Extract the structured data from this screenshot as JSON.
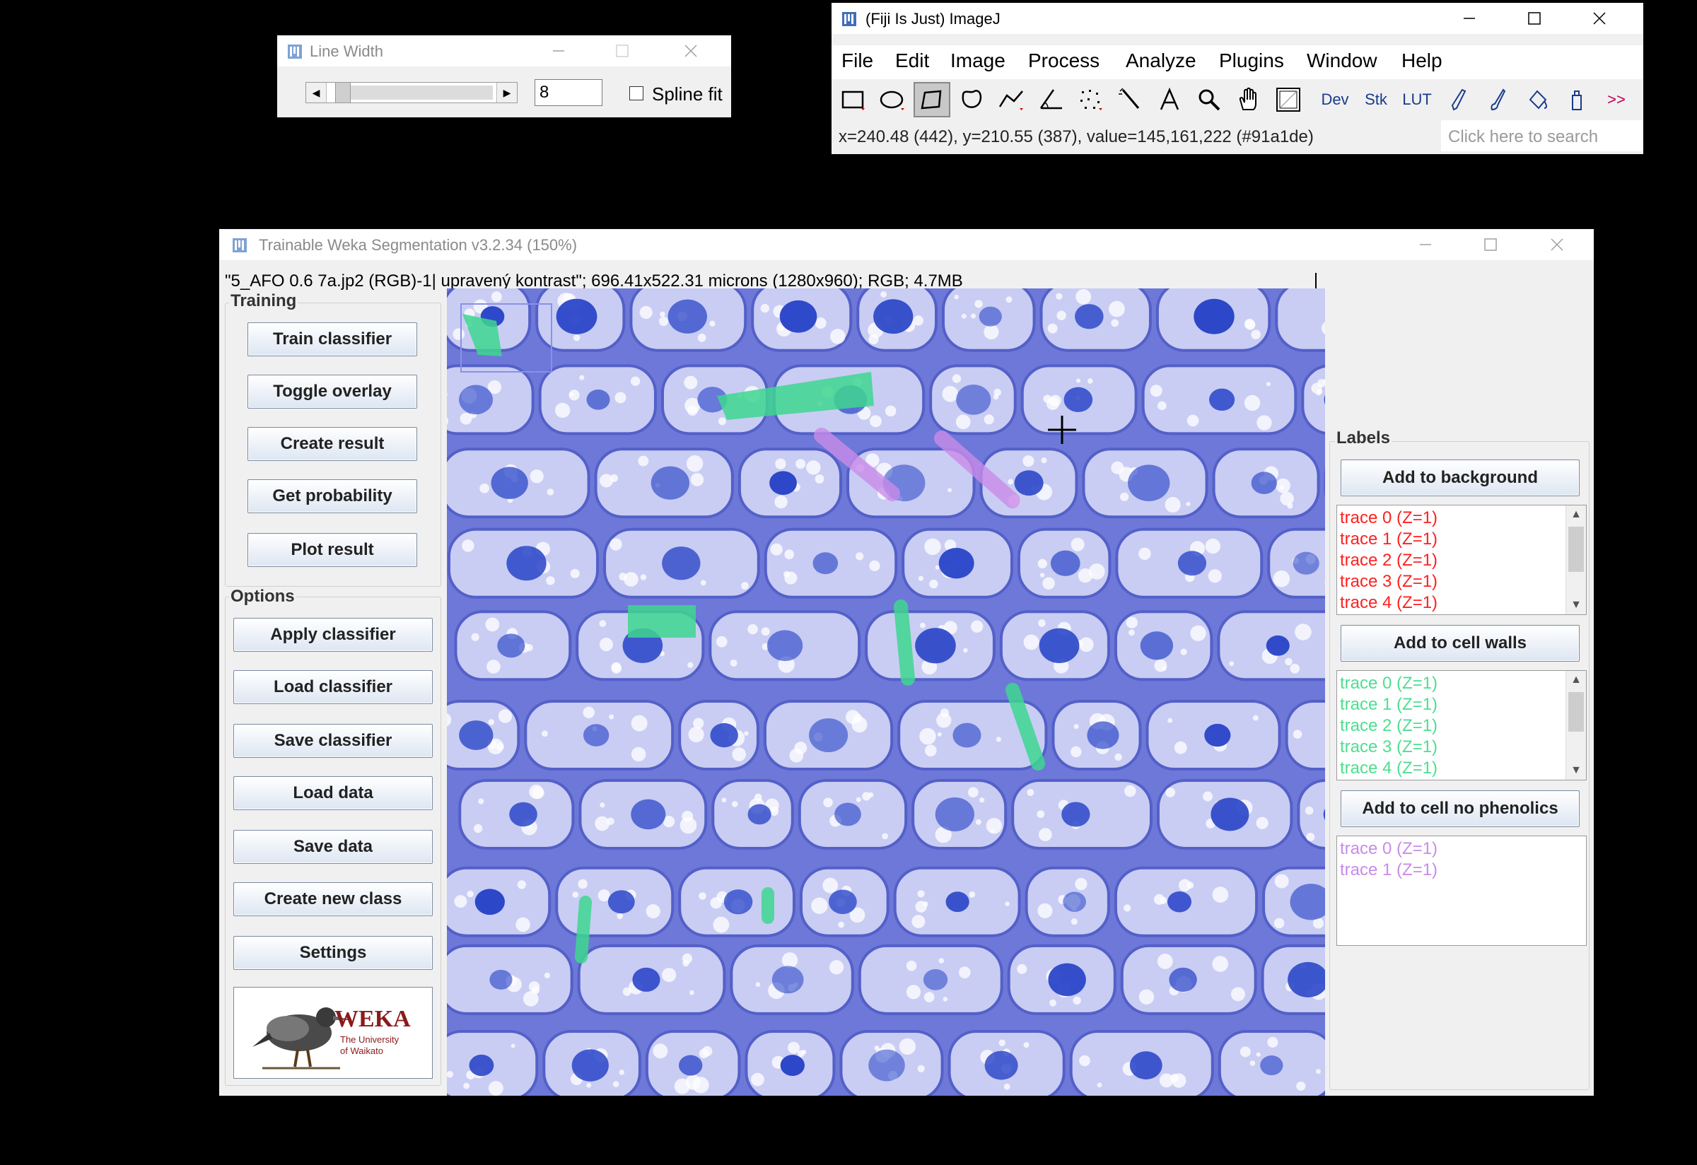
{
  "line_width_dialog": {
    "title": "Line Width",
    "value": "8",
    "spline_fit_label": "Spline fit",
    "spline_fit_checked": false,
    "slider_fraction": 0.05
  },
  "imagej": {
    "title": "(Fiji Is Just) ImageJ",
    "menu": [
      "File",
      "Edit",
      "Image",
      "Process",
      "Analyze",
      "Plugins",
      "Window",
      "Help"
    ],
    "tools": [
      "Dev",
      "Stk",
      "LUT",
      ">>"
    ],
    "status": "x=240.48 (442), y=210.55 (387), value=145,161,222 (#91a1de)",
    "search_placeholder": "Click here to search"
  },
  "weka": {
    "title": "Trainable Weka Segmentation v3.2.34 (150%)",
    "info": "\"5_AFO 0.6 7a.jp2 (RGB)-1| upravený kontrast\"; 696.41x522.31 microns (1280x960); RGB; 4.7MB",
    "training": {
      "label": "Training",
      "buttons": [
        "Train classifier",
        "Toggle overlay",
        "Create result",
        "Get probability",
        "Plot result"
      ]
    },
    "options": {
      "label": "Options",
      "buttons": [
        "Apply classifier",
        "Load classifier",
        "Save classifier",
        "Load data",
        "Save data",
        "Create new class",
        "Settings"
      ]
    },
    "logo": {
      "text": "WEKA",
      "subtitle_1": "The University",
      "subtitle_2": "of Waikato"
    },
    "labels": {
      "label": "Labels",
      "classes": [
        {
          "button": "Add to background",
          "color": "#ff2020",
          "traces": [
            "trace 0 (Z=1)",
            "trace 1 (Z=1)",
            "trace 2 (Z=1)",
            "trace 3 (Z=1)",
            "trace 4 (Z=1)"
          ]
        },
        {
          "button": "Add to cell walls",
          "color": "#4ddf8f",
          "traces": [
            "trace 0 (Z=1)",
            "trace 1 (Z=1)",
            "trace 2 (Z=1)",
            "trace 3 (Z=1)",
            "trace 4 (Z=1)"
          ]
        },
        {
          "button": "Add to cell no phenolics",
          "color": "#c98be8",
          "traces": [
            "trace 0 (Z=1)",
            "trace 1 (Z=1)"
          ]
        }
      ]
    }
  },
  "colors": {
    "cell_background": "#6d78d8",
    "cell_fill": "#c9cdf3",
    "nucleus": "#2b46c8",
    "trace_green": "#3ed68f",
    "trace_purple": "#c98be8"
  }
}
